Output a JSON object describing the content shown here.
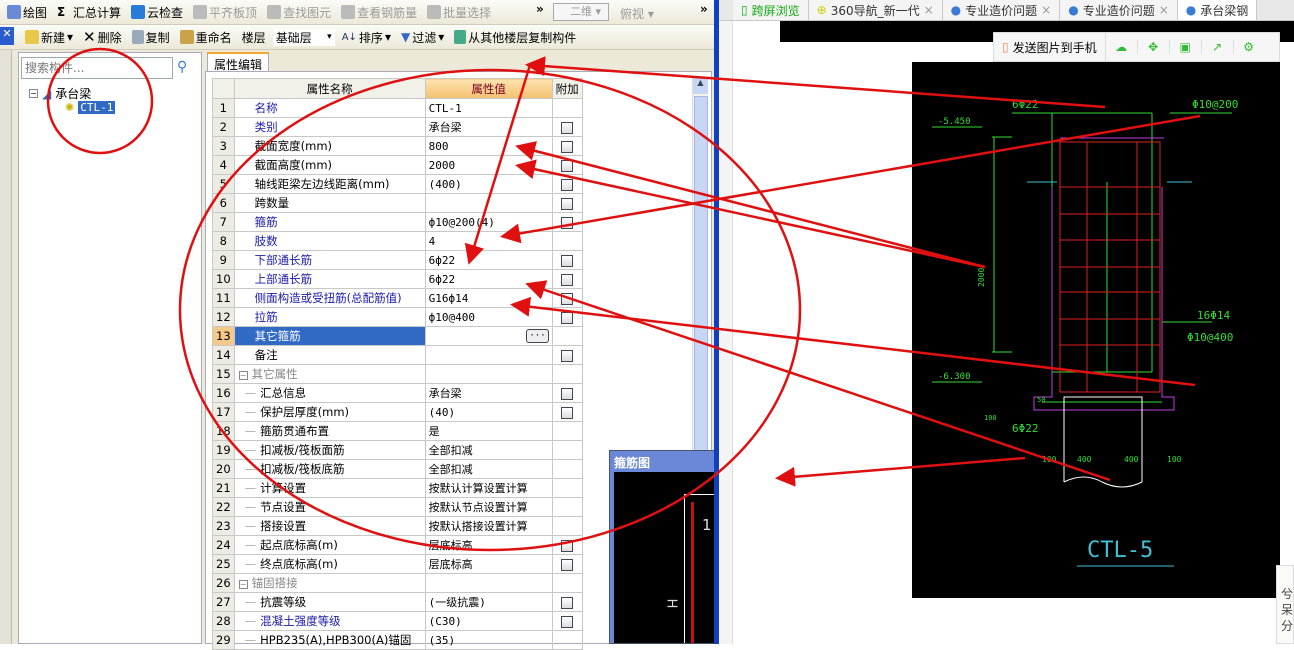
{
  "app": {
    "toolbar1": [
      {
        "label": "绘图",
        "icon": "draw-icon"
      },
      {
        "label": "汇总计算",
        "icon": "sigma-icon"
      },
      {
        "label": "云检查",
        "icon": "cloud-check-icon"
      },
      {
        "label": "平齐板顶",
        "icon": "align-icon",
        "disabled": true
      },
      {
        "label": "查找图元",
        "icon": "binoculars-icon",
        "disabled": true
      },
      {
        "label": "查看钢筋量",
        "icon": "rebar-icon",
        "disabled": true
      },
      {
        "label": "批量选择",
        "icon": "batch-select-icon",
        "disabled": true
      }
    ],
    "view_select": "二维",
    "view_mode": "俯视",
    "more": "»",
    "toolbar2": {
      "new": "新建",
      "delete": "删除",
      "copy": "复制",
      "rename": "重命名",
      "floor_label": "楼层",
      "floor_value": "基础层",
      "sort": "排序",
      "filter": "过滤",
      "copy_from": "从其他楼层复制构件"
    },
    "search_placeholder": "搜索构件...",
    "tree": {
      "root": "承台梁",
      "child": "CTL-1"
    },
    "panel_tab": "属性编辑",
    "table": {
      "headers": [
        "属性名称",
        "属性值",
        "附加"
      ],
      "rows": [
        {
          "n": "1",
          "name": "名称",
          "value": "CTL-1",
          "blue": true,
          "cb": false
        },
        {
          "n": "2",
          "name": "类别",
          "value": "承台梁",
          "blue": true,
          "cb": true
        },
        {
          "n": "3",
          "name": "截面宽度(mm)",
          "value": "800",
          "cb": true
        },
        {
          "n": "4",
          "name": "截面高度(mm)",
          "value": "2000",
          "cb": true
        },
        {
          "n": "5",
          "name": "轴线距梁左边线距离(mm)",
          "value": "(400)",
          "cb": true
        },
        {
          "n": "6",
          "name": "跨数量",
          "value": "",
          "cb": true
        },
        {
          "n": "7",
          "name": "箍筋",
          "value": "ф10@200(4)",
          "blue": true,
          "cb": true
        },
        {
          "n": "8",
          "name": "肢数",
          "value": "4",
          "blue": true,
          "cb": false
        },
        {
          "n": "9",
          "name": "下部通长筋",
          "value": "6ф22",
          "blue": true,
          "cb": true
        },
        {
          "n": "10",
          "name": "上部通长筋",
          "value": "6ф22",
          "blue": true,
          "cb": true
        },
        {
          "n": "11",
          "name": "侧面构造或受扭筋(总配筋值)",
          "value": "G16ф14",
          "blue": true,
          "cb": true
        },
        {
          "n": "12",
          "name": "拉筋",
          "value": "ф10@400",
          "blue": true,
          "cb": true
        },
        {
          "n": "13",
          "name": "其它箍筋",
          "value": "",
          "selected": true,
          "ellipsis": "···"
        },
        {
          "n": "14",
          "name": "备注",
          "value": "",
          "cb": true
        },
        {
          "n": "15",
          "name": "其它属性",
          "value": "",
          "group": true
        },
        {
          "n": "16",
          "name": "汇总信息",
          "value": "承台梁",
          "child": true,
          "cb": true
        },
        {
          "n": "17",
          "name": "保护层厚度(mm)",
          "value": "(40)",
          "child": true,
          "cb": true
        },
        {
          "n": "18",
          "name": "箍筋贯通布置",
          "value": "是",
          "child": true
        },
        {
          "n": "19",
          "name": "扣减板/筏板面筋",
          "value": "全部扣减",
          "child": true
        },
        {
          "n": "20",
          "name": "扣减板/筏板底筋",
          "value": "全部扣减",
          "child": true
        },
        {
          "n": "21",
          "name": "计算设置",
          "value": "按默认计算设置计算",
          "child": true
        },
        {
          "n": "22",
          "name": "节点设置",
          "value": "按默认节点设置计算",
          "child": true
        },
        {
          "n": "23",
          "name": "搭接设置",
          "value": "按默认搭接设置计算",
          "child": true
        },
        {
          "n": "24",
          "name": "起点底标高(m)",
          "value": "层底标高",
          "child": true,
          "cb": true
        },
        {
          "n": "25",
          "name": "终点底标高(m)",
          "value": "层底标高",
          "child": true,
          "cb": true
        },
        {
          "n": "26",
          "name": "锚固搭接",
          "value": "",
          "group": true
        },
        {
          "n": "27",
          "name": "抗震等级",
          "value": "(一级抗震)",
          "child": true,
          "cb": true
        },
        {
          "n": "28",
          "name": "混凝土强度等级",
          "value": "(C30)",
          "child": true,
          "blue": true,
          "cb": true
        },
        {
          "n": "29",
          "name": "HPB235(A),HPB300(A)锚固",
          "value": "(35)",
          "child": true
        }
      ]
    },
    "popup": {
      "title": "箍筋图",
      "label_h": "H",
      "label_1": "1"
    }
  },
  "browser": {
    "tabs": [
      {
        "label": "跨屏浏览",
        "icon": "phone-icon"
      },
      {
        "label": "360导航_新一代",
        "icon": "360-icon",
        "close": "×"
      },
      {
        "label": "专业造价问题",
        "icon": "user-icon",
        "close": "×"
      },
      {
        "label": "专业造价问题",
        "icon": "user-icon",
        "close": "×"
      },
      {
        "label": "承台梁钢",
        "icon": "user-icon",
        "active": true
      }
    ],
    "send_to_phone": "发送图片到手机",
    "cad": {
      "top_bar": "6Φ22",
      "stirrup": "Φ10@200",
      "elev_top": "-5.450",
      "height": "2000",
      "side": "16Φ14",
      "tie": "Φ10@400",
      "elev_bottom": "-6.300",
      "bottom_bar": "6Φ22",
      "dims": [
        "100",
        "400",
        "400",
        "100"
      ],
      "cover": "50",
      "base": "100",
      "title": "CTL-5"
    },
    "side_popup_text": [
      "兮",
      "呆",
      "分"
    ]
  },
  "colors": {
    "annotation": "#e01010",
    "selection": "#316ac5",
    "cad_bg": "#000000",
    "cad_green": "#33dd33",
    "cad_red": "#e02020",
    "cad_magenta": "#c040e0",
    "cad_cyan": "#40c0d0",
    "window_border": "#1040c0"
  }
}
